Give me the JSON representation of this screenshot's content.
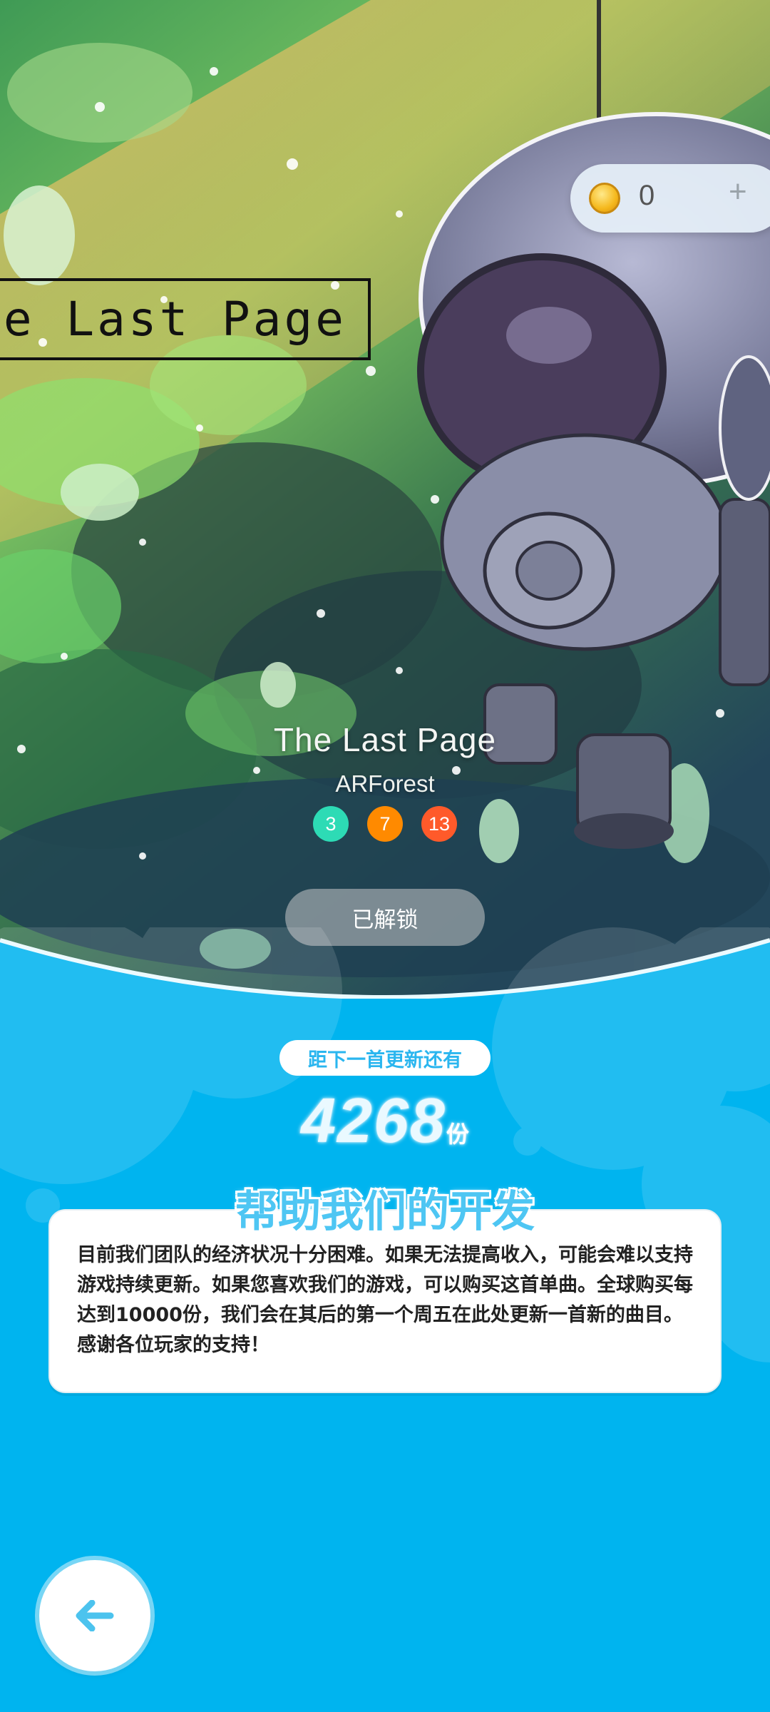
{
  "artwork": {
    "banner_title": "e Last Page"
  },
  "currency": {
    "coin_count": "0",
    "add_label": "+"
  },
  "song": {
    "title": "The Last Page",
    "artist": "ARForest",
    "levels": [
      {
        "value": "3",
        "color": "#2ddbb5"
      },
      {
        "value": "7",
        "color": "#ff8a00"
      },
      {
        "value": "13",
        "color": "#ff5a2a"
      }
    ],
    "unlock_label": "已解锁"
  },
  "update": {
    "countdown_label": "距下一首更新还有",
    "remaining": "4268",
    "unit": "份"
  },
  "help": {
    "title": "帮助我们的开发",
    "body": "目前我们团队的经济状况十分困难。如果无法提高收入，可能会难以支持游戏持续更新。如果您喜欢我们的游戏，可以购买这首单曲。全球购买每达到10000份，我们会在其后的第一个周五在此处更新一首新的曲目。感谢各位玩家的支持！"
  },
  "colors": {
    "sky_blue": "#00b4ef",
    "accent": "#2ab6ef"
  },
  "icons": {
    "coin": "coin-icon",
    "back": "back-arrow-icon"
  }
}
